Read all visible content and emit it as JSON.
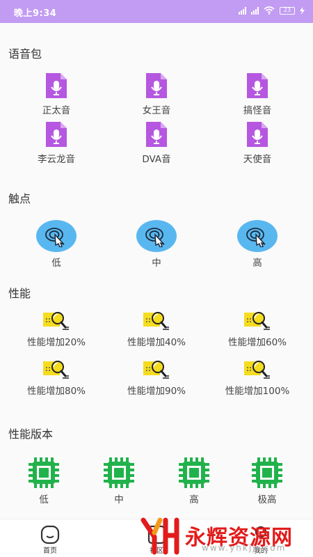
{
  "status_bar": {
    "time": "晚上9:34",
    "battery": "23"
  },
  "sections": {
    "voice_pack": {
      "title": "语音包",
      "items": [
        "正太音",
        "女王音",
        "搞怪音",
        "李云龙音",
        "DVA音",
        "天使音"
      ]
    },
    "touch": {
      "title": "触点",
      "items": [
        "低",
        "中",
        "高"
      ]
    },
    "performance": {
      "title": "性能",
      "items": [
        "性能增加20%",
        "性能增加40%",
        "性能增加60%",
        "性能增加80%",
        "性能增加90%",
        "性能增加100%"
      ]
    },
    "performance_version": {
      "title": "性能版本",
      "items": [
        "低",
        "中",
        "高",
        "极高"
      ]
    }
  },
  "bottom_nav": {
    "home": "首页",
    "community": "社区",
    "mine": "我的"
  },
  "watermark": {
    "text": "永辉资源网",
    "url": "www.yhkjjj.com"
  },
  "colors": {
    "status_bar": "#c29bf2",
    "file_icon": "#b557e0",
    "touch_icon": "#59b7f0",
    "perf_icon": "#f5dc1e",
    "chip_icon": "#21b24b",
    "watermark": "#e21b1b"
  }
}
